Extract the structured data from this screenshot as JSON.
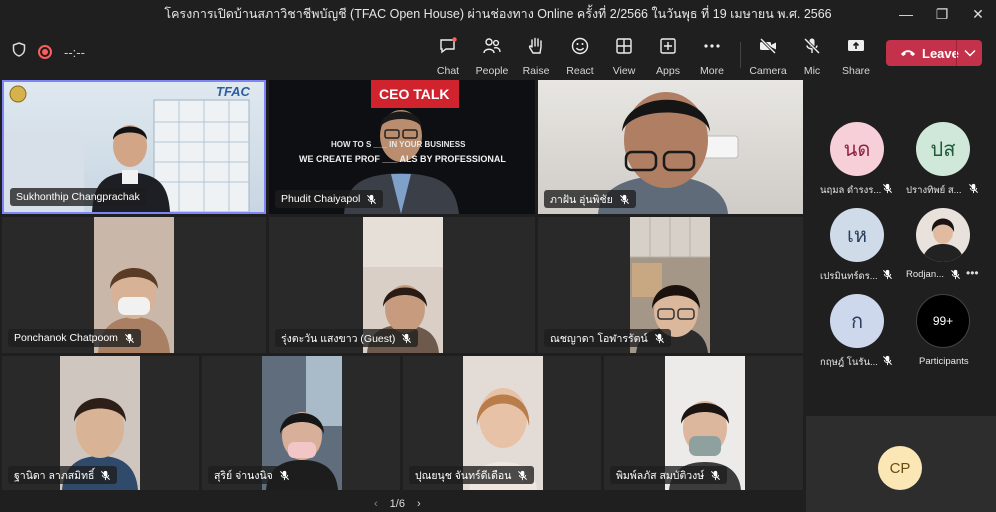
{
  "window": {
    "title": "โครงการเปิดบ้านสภาวิชาชีพบัญชี (TFAC Open House) ผ่านช่องทาง Online ครั้งที่ 2/2566 ในวันพุธ ที่ 19 เมษายน พ.ศ. 2566",
    "controls": [
      "minimize-icon",
      "maximize-icon",
      "close-icon"
    ]
  },
  "toolbar": {
    "timer": "--:--",
    "buttons": {
      "chat": "Chat",
      "people": "People",
      "raise": "Raise",
      "react": "React",
      "view": "View",
      "apps": "Apps",
      "more": "More",
      "camera": "Camera",
      "mic": "Mic",
      "share": "Share"
    },
    "leave": "Leave",
    "accent_color": "#c4314b"
  },
  "tiles": [
    {
      "name": "Sukhonthip Changprachak",
      "muted": false,
      "pinned": true
    },
    {
      "name": "Phudit Chaiyapol",
      "muted": true,
      "logo_text": "CEO TALK",
      "banner1": "HOW TO S ___ IN YOUR BUSINESS",
      "banner2": "WE CREATE PROF ___ ALS BY PROFESSIONAL"
    },
    {
      "name": "ภาฝัน อุ่นพิชัย",
      "muted": true
    },
    {
      "name": "Ponchanok Chatpoom",
      "muted": true
    },
    {
      "name": "รุ่งตะวัน แสงขาว (Guest)",
      "muted": true
    },
    {
      "name": "ณชญาดา โอฬารรัตน์",
      "muted": true
    },
    {
      "name": "ฐานิดา ลาภสมิทธิ์",
      "muted": true
    },
    {
      "name": "สุริย์ จ่านงนิจ",
      "muted": true
    },
    {
      "name": "ปุณยนุช จันทร์ดีเดือน",
      "muted": true
    },
    {
      "name": "พิมพ์ลภัส สมบัติวงษ์",
      "muted": true
    }
  ],
  "tfac_logo_text": "TFAC",
  "side_participants": [
    {
      "initials": "นด",
      "name": "นฤมล ดำรงร...",
      "bg": "#f6cfd8",
      "fg": "#8f2240"
    },
    {
      "initials": "ปส",
      "name": "ปรางทิพย์ ส...",
      "bg": "#cfe8da",
      "fg": "#1f5b3a"
    },
    {
      "initials": "เห",
      "name": "เปรมินทร์ดร...",
      "bg": "#cfdbe8",
      "fg": "#2a3f5e"
    },
    {
      "initials": "",
      "name": "Rodjan...",
      "bg": "#e9e2dc",
      "fg": "#333"
    },
    {
      "initials": "ก",
      "name": "กฤษฎ์ โนรัน...",
      "bg": "#cdd8ec",
      "fg": "#2f3f63"
    },
    {
      "initials": "99+",
      "name": "Participants",
      "bg": "#000000",
      "fg": "#ffffff"
    }
  ],
  "self": {
    "initials": "CP"
  },
  "pager": {
    "label": "1/6"
  }
}
